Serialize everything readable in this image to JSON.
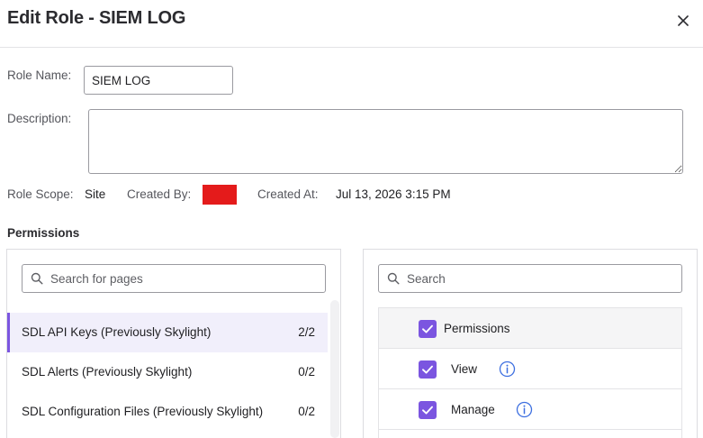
{
  "dialog": {
    "title": "Edit Role - SIEM LOG",
    "close_icon": "close-icon"
  },
  "form": {
    "role_name_label": "Role Name:",
    "role_name_value": "SIEM LOG",
    "description_label": "Description:",
    "description_value": "",
    "role_scope_label": "Role Scope:",
    "role_scope_value": "Site",
    "created_by_label": "Created By:",
    "created_by_color": "#e41b1b",
    "created_at_label": "Created At:",
    "created_at_value": "Jul 13, 2026 3:15 PM"
  },
  "permissions": {
    "heading": "Permissions",
    "pages_search_placeholder": "Search for pages",
    "pages": [
      {
        "name": "SDL API Keys (Previously Skylight)",
        "count": "2/2",
        "active": true
      },
      {
        "name": "SDL Alerts (Previously Skylight)",
        "count": "0/2",
        "active": false
      },
      {
        "name": "SDL Configuration Files (Previously Skylight)",
        "count": "0/2",
        "active": false
      }
    ],
    "perm_search_placeholder": "Search",
    "table": {
      "header_label": "Permissions",
      "header_checked": true,
      "rows": [
        {
          "label": "View",
          "checked": true,
          "icon": "info-icon"
        },
        {
          "label": "Manage",
          "checked": true,
          "icon": "info-icon"
        }
      ]
    }
  },
  "colors": {
    "accent": "#7b55e0",
    "active_row_bg": "#f1effb",
    "info_icon": "#3d6fe0"
  }
}
